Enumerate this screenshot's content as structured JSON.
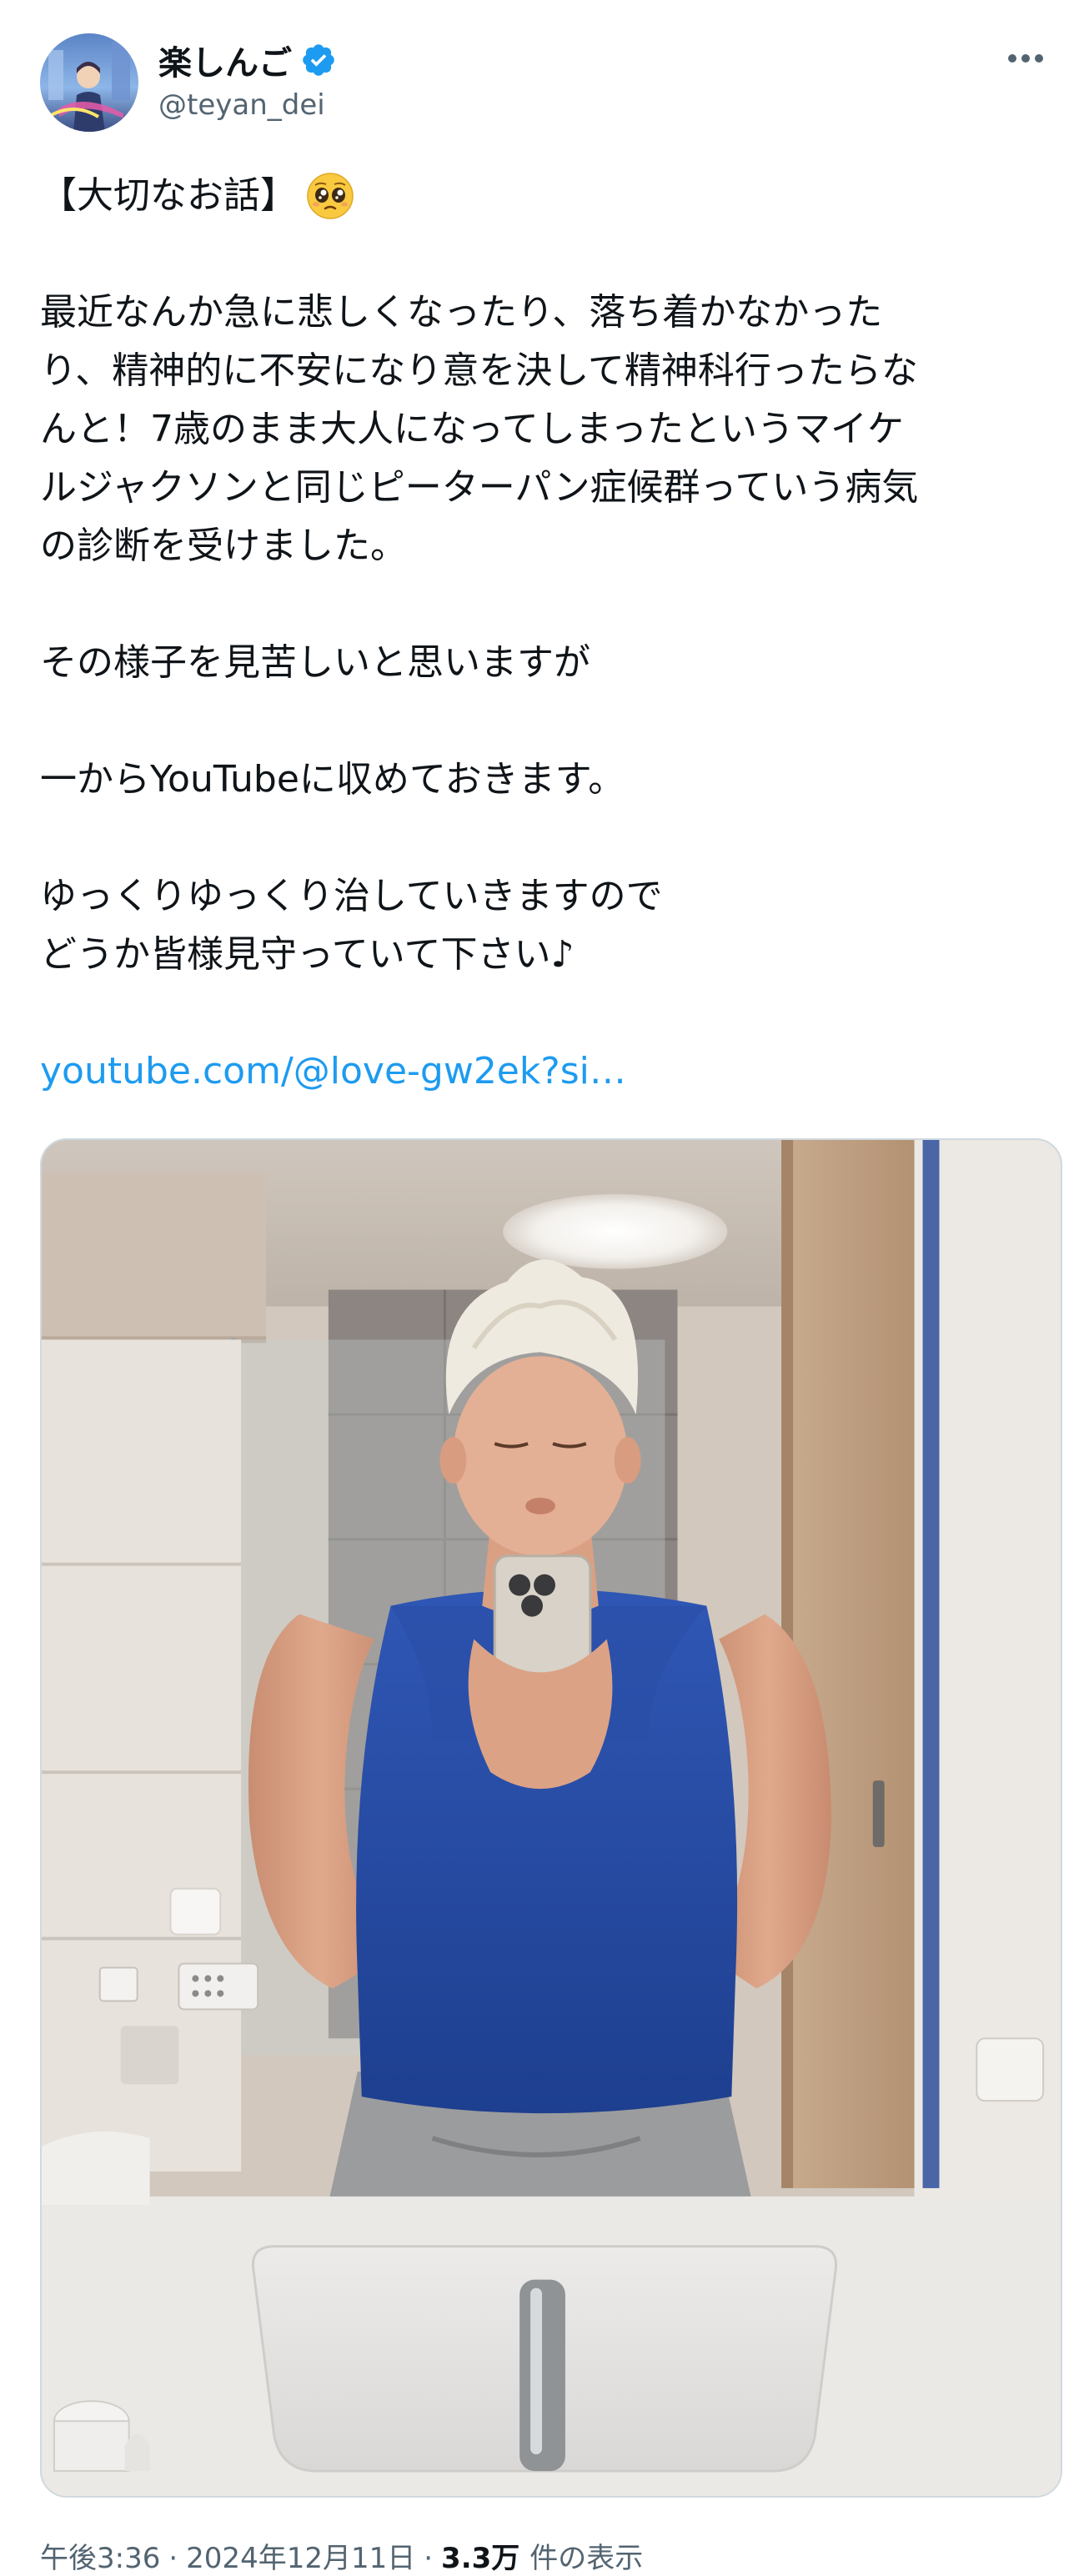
{
  "author": {
    "display_name": "楽しんご",
    "handle": "@teyan_dei",
    "verified": true,
    "verified_color": "#1d9bf0"
  },
  "tweet": {
    "title": "【大切なお話】",
    "title_emoji": "pleading-face",
    "lines_paragraph1": [
      "最近なんか急に悲しくなったり、落ち着かなかった",
      "り、精神的に不安になり意を決して精神科行ったらな",
      "んと！7歳のまま大人になってしまったというマイケ",
      "ルジャクソンと同じピーターパン症候群っていう病気",
      "の診断を受けました。"
    ],
    "line_paragraph2": "その様子を見苦しいと思いますが",
    "line_paragraph3": "一からYouTubeに収めておきます。",
    "lines_paragraph4": [
      "ゆっくりゆっくり治していきますので",
      "どうか皆様見守っていて下さい♪"
    ],
    "link_text": "youtube.com/@love-gw2ek?si…",
    "link_color": "#1d9bf0"
  },
  "media": {
    "type": "photo",
    "subject": "mirror selfie in bathroom"
  },
  "meta": {
    "time": "午後3:36",
    "separator": "·",
    "date": "2024年12月11日",
    "views_count": "3.3万",
    "views_label": "件の表示"
  },
  "icons": {
    "more": "more-horizontal-icon",
    "verified": "verified-badge-icon"
  }
}
